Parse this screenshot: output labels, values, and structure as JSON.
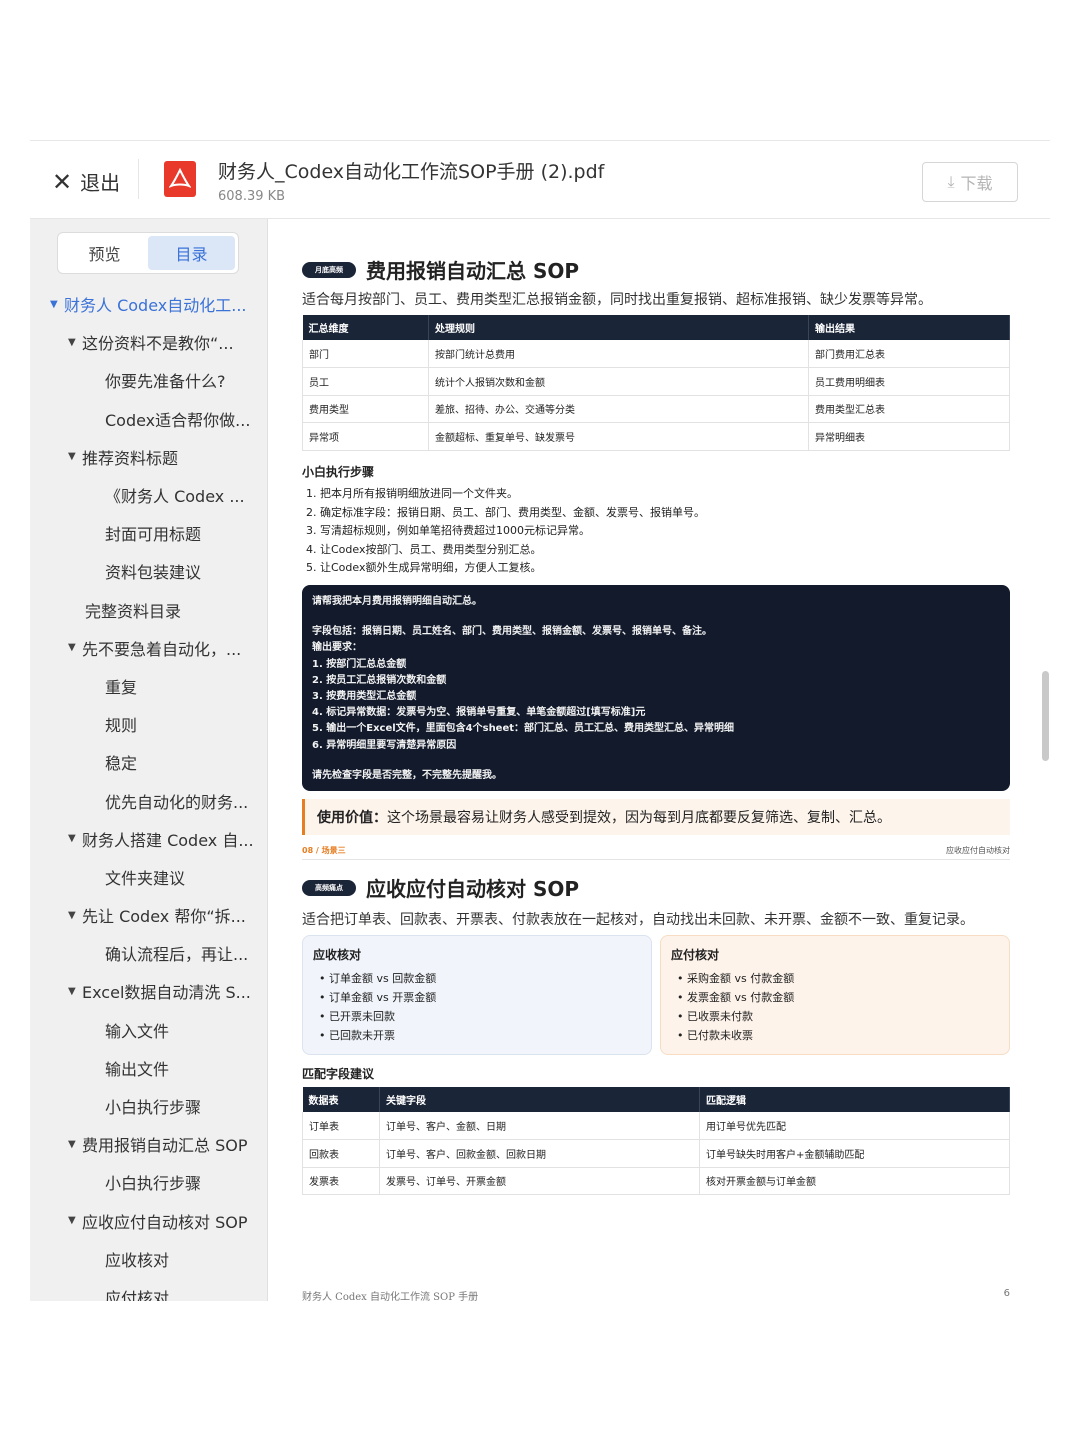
{
  "header": {
    "exit_label": "退出",
    "file_name": "财务人_Codex自动化工作流SOP手册 (2).pdf",
    "file_size": "608.39 KB",
    "download_label": "下载"
  },
  "sidebar": {
    "tabs": [
      "预览",
      "目录"
    ],
    "active_tab": "目录",
    "toc": [
      {
        "label": "财务人 Codex自动化工...",
        "level": 0,
        "expanded": true
      },
      {
        "label": "这份资料不是教你“...",
        "level": 1,
        "expanded": true
      },
      {
        "label": "你要先准备什么?",
        "level": 2
      },
      {
        "label": "Codex适合帮你做...",
        "level": 2
      },
      {
        "label": "推荐资料标题",
        "level": 1,
        "expanded": true
      },
      {
        "label": "《财务人 Codex ...",
        "level": 2
      },
      {
        "label": "封面可用标题",
        "level": 2
      },
      {
        "label": "资料包装建议",
        "level": 2
      },
      {
        "label": "完整资料目录",
        "level": 1,
        "expanded": false
      },
      {
        "label": "先不要急着自动化，...",
        "level": 1,
        "expanded": true
      },
      {
        "label": "重复",
        "level": 2
      },
      {
        "label": "规则",
        "level": 2
      },
      {
        "label": "稳定",
        "level": 2
      },
      {
        "label": "优先自动化的财务...",
        "level": 2
      },
      {
        "label": "财务人搭建 Codex 自...",
        "level": 1,
        "expanded": true
      },
      {
        "label": "文件夹建议",
        "level": 2
      },
      {
        "label": "先让 Codex 帮你“拆...",
        "level": 1,
        "expanded": true
      },
      {
        "label": "确认流程后，再让...",
        "level": 2
      },
      {
        "label": "Excel数据自动清洗 S...",
        "level": 1,
        "expanded": true
      },
      {
        "label": "输入文件",
        "level": 2
      },
      {
        "label": "输出文件",
        "level": 2
      },
      {
        "label": "小白执行步骤",
        "level": 2
      },
      {
        "label": "费用报销自动汇总 SOP",
        "level": 1,
        "expanded": true
      },
      {
        "label": "小白执行步骤",
        "level": 2
      },
      {
        "label": "应收应付自动核对 SOP",
        "level": 1,
        "expanded": true
      },
      {
        "label": "应收核对",
        "level": 2
      },
      {
        "label": "应付核对",
        "level": 2
      }
    ]
  },
  "page": {
    "section1": {
      "badge": "月底高频",
      "title": "费用报销自动汇总 SOP",
      "desc": "适合每月按部门、员工、费用类型汇总报销金额，同时找出重复报销、超标准报销、缺少发票等异常。",
      "table": {
        "headers": [
          "汇总维度",
          "处理规则",
          "输出结果"
        ],
        "rows": [
          [
            "部门",
            "按部门统计总费用",
            "部门费用汇总表"
          ],
          [
            "员工",
            "统计个人报销次数和金额",
            "员工费用明细表"
          ],
          [
            "费用类型",
            "差旅、招待、办公、交通等分类",
            "费用类型汇总表"
          ],
          [
            "异常项",
            "金额超标、重复单号、缺发票号",
            "异常明细表"
          ]
        ]
      },
      "steps_title": "小白执行步骤",
      "steps": [
        "1. 把本月所有报销明细放进同一个文件夹。",
        "2. 确定标准字段：报销日期、员工、部门、费用类型、金额、发票号、报销单号。",
        "3. 写清超标规则，例如单笔招待费超过1000元标记异常。",
        "4. 让Codex按部门、员工、费用类型分别汇总。",
        "5. 让Codex额外生成异常明细，方便人工复核。"
      ],
      "prompt": {
        "line1": "请帮我把本月费用报销明细自动汇总。",
        "lines": [
          "字段包括：报销日期、员工姓名、部门、费用类型、报销金额、发票号、报销单号、备注。",
          "输出要求：",
          "1. 按部门汇总总金额",
          "2. 按员工汇总报销次数和金额",
          "3. 按费用类型汇总金额",
          "4. 标记异常数据：发票号为空、报销单号重复、单笔金额超过[填写标准]元",
          "5. 输出一个Excel文件，里面包含4个sheet：部门汇总、员工汇总、费用类型汇总、异常明细",
          "6. 异常明细里要写清楚异常原因"
        ],
        "last": "请先检查字段是否完整，不完整先提醒我。"
      },
      "value_label": "使用价值：",
      "value_text": "这个场景最容易让财务人感受到提效，因为每到月底都要反复筛选、复制、汇总。"
    },
    "divider": {
      "left": "08 / 场景三",
      "right": "应收应付自动核对"
    },
    "section2": {
      "badge": "高频痛点",
      "title": "应收应付自动核对 SOP",
      "desc": "适合把订单表、回款表、开票表、付款表放在一起核对，自动找出未回款、未开票、金额不一致、重复记录。",
      "card_left": {
        "title": "应收核对",
        "items": [
          "订单金额 vs 回款金额",
          "订单金额 vs 开票金额",
          "已开票未回款",
          "已回款未开票"
        ]
      },
      "card_right": {
        "title": "应付核对",
        "items": [
          "采购金额 vs 付款金额",
          "发票金额 vs 付款金额",
          "已收票未付款",
          "已付款未收票"
        ]
      },
      "match_title": "匹配字段建议",
      "table": {
        "headers": [
          "数据表",
          "关键字段",
          "匹配逻辑"
        ],
        "rows": [
          [
            "订单表",
            "订单号、客户、金额、日期",
            "用订单号优先匹配"
          ],
          [
            "回款表",
            "订单号、客户、回款金额、回款日期",
            "订单号缺失时用客户+金额辅助匹配"
          ],
          [
            "发票表",
            "发票号、订单号、开票金额",
            "核对开票金额与订单金额"
          ]
        ]
      }
    },
    "footer": {
      "title": "财务人 Codex 自动化工作流 SOP 手册",
      "page_number": "6"
    }
  }
}
